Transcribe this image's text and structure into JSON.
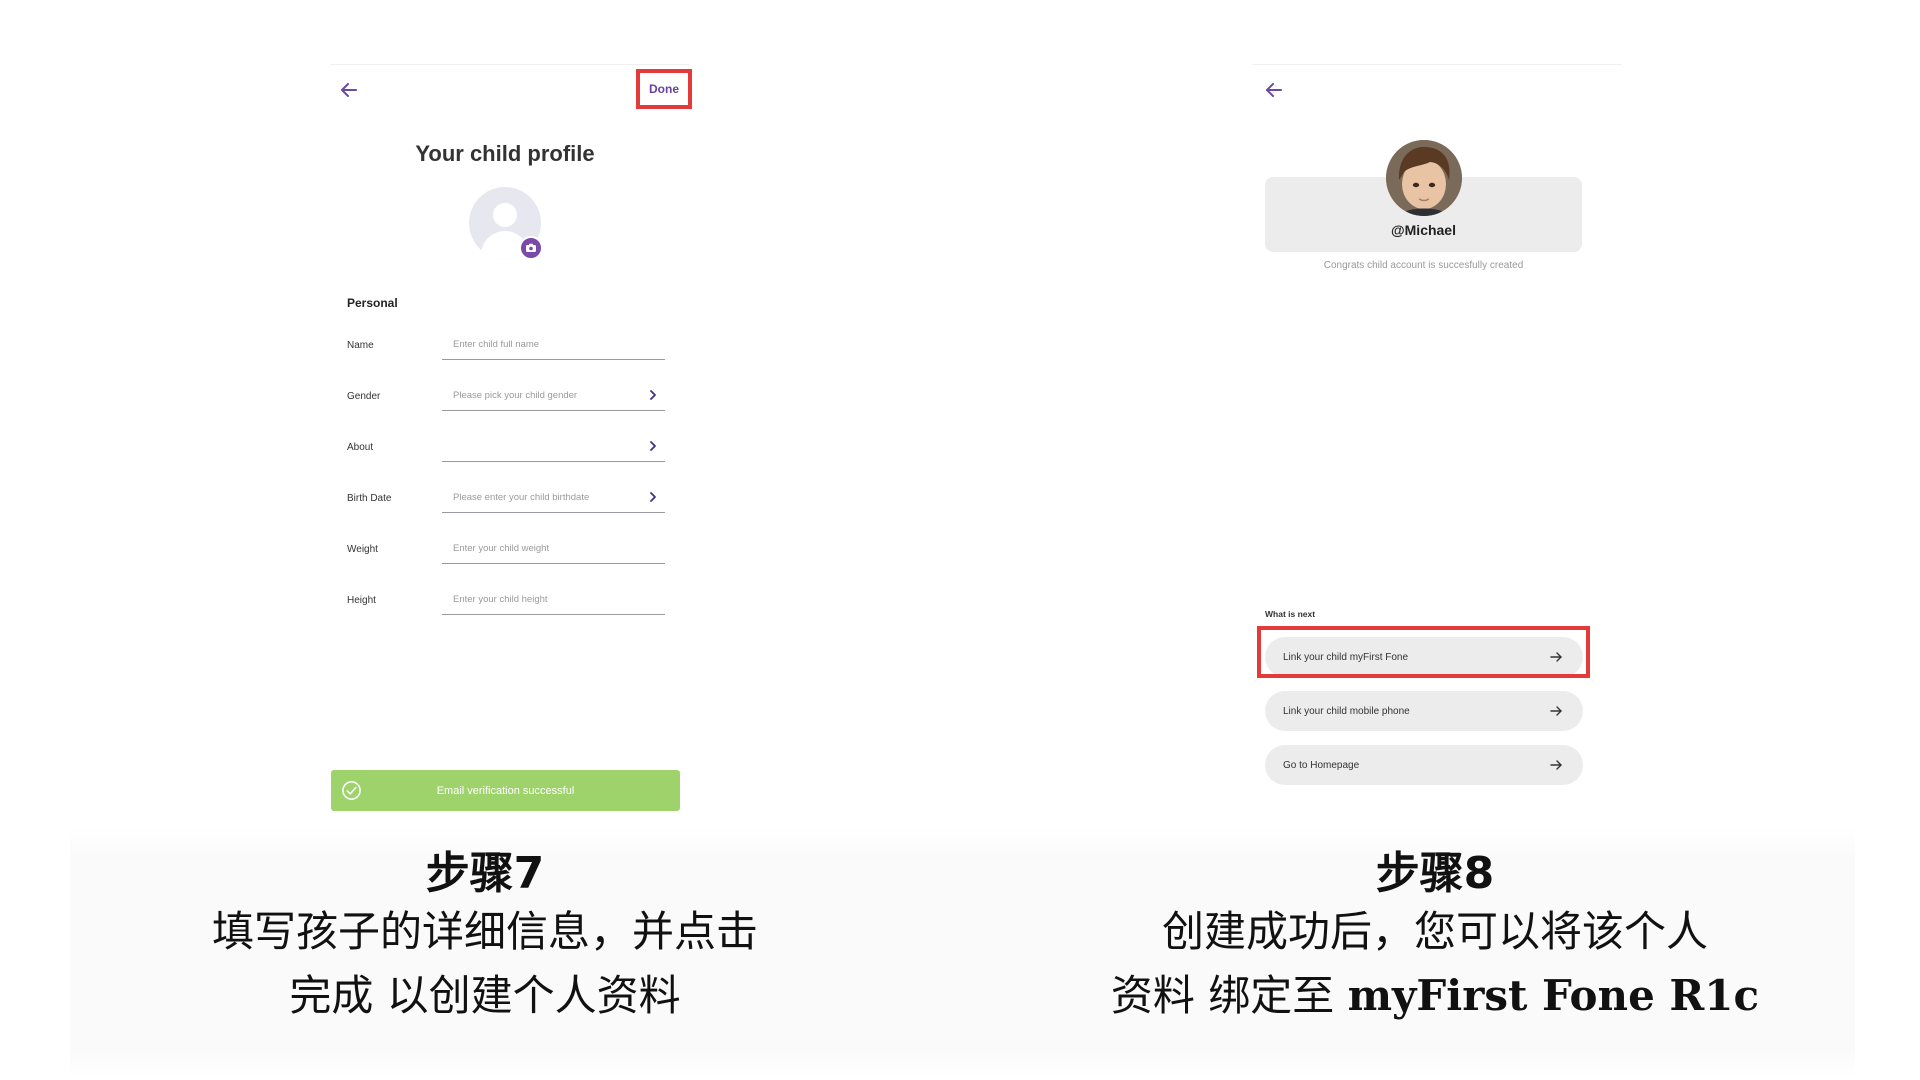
{
  "left_screen": {
    "done_label": "Done",
    "title": "Your child profile",
    "section_title": "Personal",
    "fields": [
      {
        "label": "Name",
        "placeholder": "Enter child full name",
        "chevron": false
      },
      {
        "label": "Gender",
        "placeholder": "Please pick your child gender",
        "chevron": true
      },
      {
        "label": "About",
        "placeholder": "",
        "chevron": true
      },
      {
        "label": "Birth Date",
        "placeholder": "Please enter your child birthdate",
        "chevron": true
      },
      {
        "label": "Weight",
        "placeholder": "Enter your child weight",
        "chevron": false
      },
      {
        "label": "Height",
        "placeholder": "Enter your child height",
        "chevron": false
      }
    ],
    "toast": "Email verification successful"
  },
  "right_screen": {
    "username": "@Michael",
    "congrats": "Congrats child account is succesfully created",
    "what_next": "What is next",
    "buttons": [
      {
        "label": "Link your child myFirst Fone",
        "highlighted": true
      },
      {
        "label": "Link your child mobile phone",
        "highlighted": false
      },
      {
        "label": "Go to Homepage",
        "highlighted": false
      }
    ]
  },
  "captions": {
    "left": {
      "step": "步骤7",
      "line1": "填写孩子的详细信息，并点击",
      "line2": "完成 以创建个人资料"
    },
    "right": {
      "step": "步骤8",
      "line1": "创建成功后，您可以将该个人",
      "line2_prefix": "资料 绑定至 ",
      "line2_brand": "myFirst Fone R1c"
    }
  },
  "colors": {
    "accent_purple": "#6b3fa0",
    "highlight_red": "#e53a3a",
    "toast_green": "#9ed26a"
  }
}
